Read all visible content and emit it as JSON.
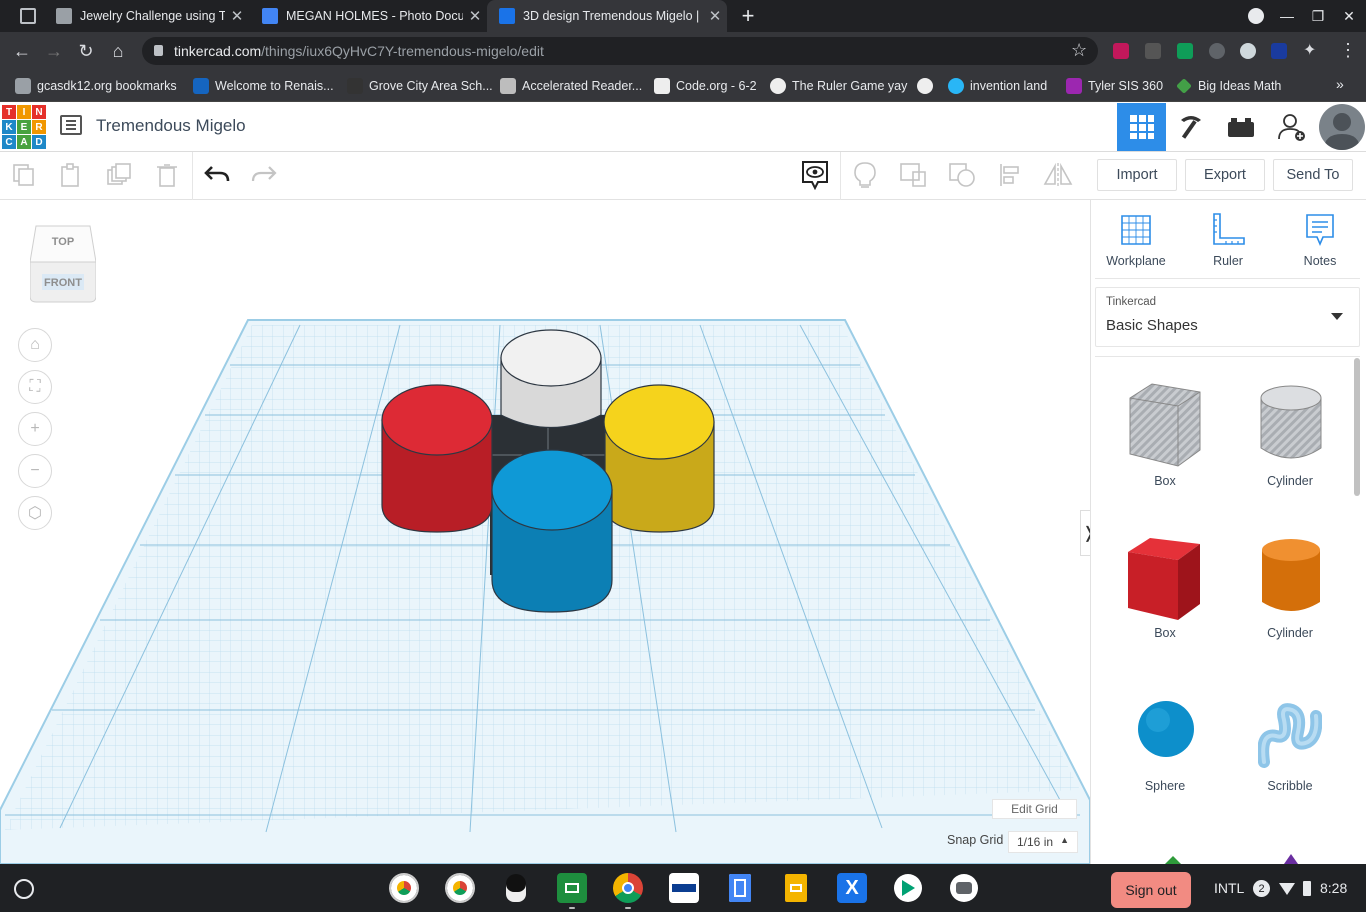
{
  "browser": {
    "tabs": [
      {
        "title": "Jewelry Challenge using T",
        "fav_color": "#9aa0a6"
      },
      {
        "title": "MEGAN HOLMES - Photo Docum",
        "fav_color": "#4285f4"
      },
      {
        "title": "3D design Tremendous Migelo | ",
        "fav_color": "#1a73e8",
        "active": true
      }
    ],
    "url_host": "tinkercad.com",
    "url_path": "/things/iux6QyHvC7Y-tremendous-migelo/edit",
    "bookmarks": [
      {
        "label": "gcasdk12.org bookmarks",
        "color": "#9aa0a6"
      },
      {
        "label": "Welcome to Renais...",
        "color": "#1565c0"
      },
      {
        "label": "Grove City Area Sch...",
        "color": "#333333"
      },
      {
        "label": "Accelerated Reader...",
        "color": "#bdbdbd"
      },
      {
        "label": "Code.org - 6-2",
        "color": "#eeeeee"
      },
      {
        "label": "The Ruler Game yay",
        "color": "#eeeeee"
      },
      {
        "label": "",
        "color": "#eeeeee"
      },
      {
        "label": "invention land",
        "color": "#29b6f6"
      },
      {
        "label": "Tyler SIS 360",
        "color": "#9c27b0"
      },
      {
        "label": "Big Ideas Math",
        "color": "#43a047"
      }
    ]
  },
  "app": {
    "logo_letters": [
      "T",
      "I",
      "N",
      "K",
      "E",
      "R",
      "C",
      "A",
      "D"
    ],
    "project_title": "Tremendous Migelo"
  },
  "toolbar": {
    "import_label": "Import",
    "export_label": "Export",
    "send_to_label": "Send To"
  },
  "viewcube": {
    "top_label": "TOP",
    "front_label": "FRONT"
  },
  "workspace": {
    "edit_grid_label": "Edit Grid",
    "snap_grid_label": "Snap Grid",
    "snap_grid_value": "1/16 in",
    "objects": [
      {
        "shape": "cylinder",
        "color": "#f0f0f0"
      },
      {
        "shape": "cylinder",
        "color": "#dd2a35"
      },
      {
        "shape": "cylinder",
        "color": "#f5d31c"
      },
      {
        "shape": "cylinder",
        "color": "#0f99d6"
      }
    ]
  },
  "panel": {
    "tools": [
      {
        "label": "Workplane",
        "icon": "workplane-icon"
      },
      {
        "label": "Ruler",
        "icon": "ruler-icon"
      },
      {
        "label": "Notes",
        "icon": "notes-icon"
      }
    ],
    "library_source": "Tinkercad",
    "library_name": "Basic Shapes",
    "shapes": [
      {
        "label": "Box",
        "variant": "hole"
      },
      {
        "label": "Cylinder",
        "variant": "hole"
      },
      {
        "label": "Box",
        "color": "#d6232a"
      },
      {
        "label": "Cylinder",
        "color": "#e07b12"
      },
      {
        "label": "Sphere",
        "color": "#0d8fcb"
      },
      {
        "label": "Scribble",
        "color": "#8ec5e8"
      }
    ]
  },
  "taskbar": {
    "sign_out_label": "Sign out",
    "input_method": "INTL",
    "notification_count": "2",
    "time": "8:28"
  }
}
